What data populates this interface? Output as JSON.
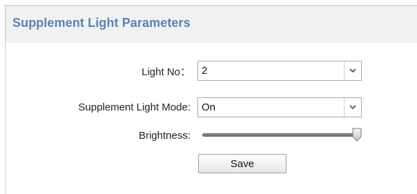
{
  "panel": {
    "title": "Supplement Light Parameters"
  },
  "form": {
    "light_no": {
      "label": "Light No：",
      "value": "2"
    },
    "mode": {
      "label": "Supplement Light Mode:",
      "value": "On"
    },
    "brightness": {
      "label": "Brightness:",
      "level_fraction": 1.0
    },
    "save_label": "Save"
  },
  "icons": {
    "dropdown": "chevron-down-icon"
  }
}
